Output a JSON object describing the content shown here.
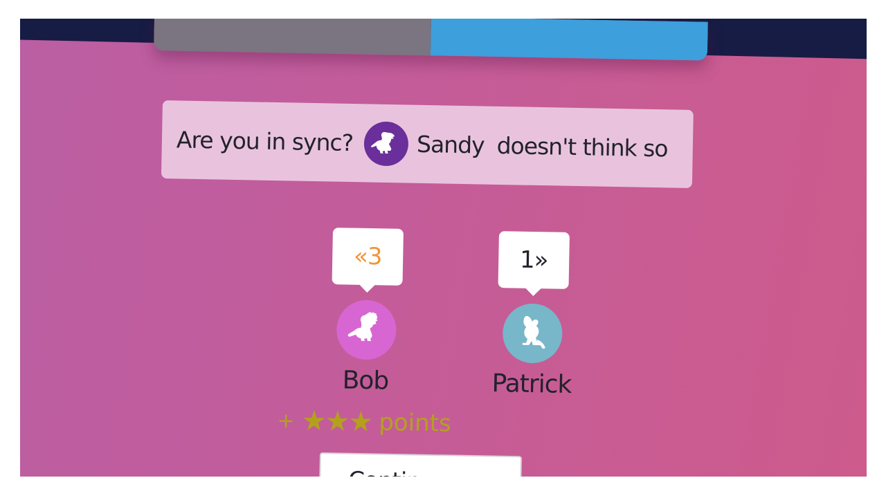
{
  "banner": {
    "question": "Are you in sync?",
    "player_name": "Sandy",
    "verdict": "doesn't think so",
    "avatar_icon": "dinosaur-icon",
    "avatar_color": "#6a2f9b"
  },
  "players": [
    {
      "name": "Bob",
      "bubble": "«3",
      "bubble_color": "#f0963a",
      "avatar_icon": "dinosaur-icon",
      "avatar_color": "#d866d2"
    },
    {
      "name": "Patrick",
      "bubble": "1»",
      "bubble_color": "#22222c",
      "avatar_icon": "kangaroo-icon",
      "avatar_color": "#78b6c9"
    }
  ],
  "reward": {
    "plus": "+",
    "stars": "★★★",
    "star_count": 3,
    "label": "points",
    "color": "#b3a11c"
  },
  "continue_button": {
    "label": "Continue"
  },
  "colors": {
    "background": "#c55c98",
    "topbar": "#171c45",
    "tab_left": "#7b7481",
    "tab_right": "#3d9fdb"
  }
}
